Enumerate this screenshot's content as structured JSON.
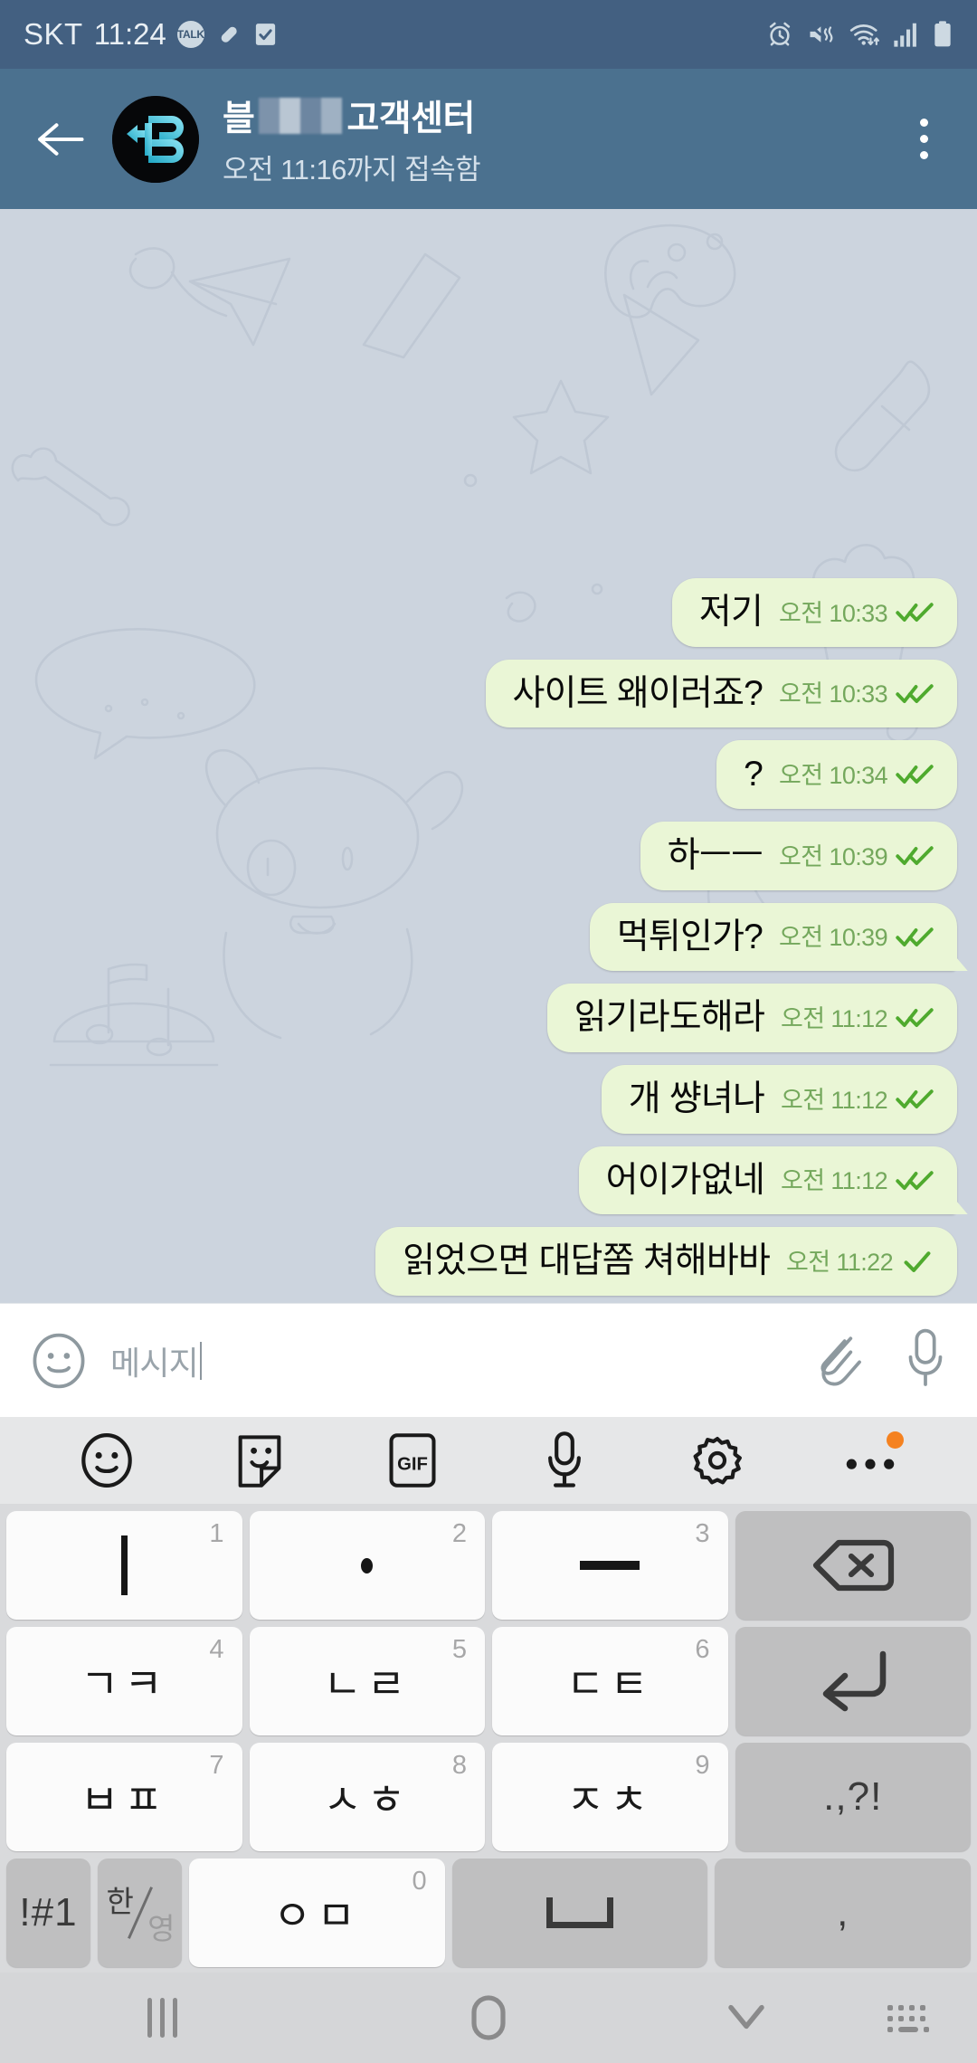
{
  "statusbar": {
    "carrier": "SKT",
    "time": "11:24",
    "talk_badge": "TALK",
    "icons_left": [
      "kakaotalk-icon",
      "pill-icon",
      "checkbox-icon"
    ],
    "icons_right": [
      "alarm-icon",
      "vibrate-mute-icon",
      "wifi-icon",
      "signal-icon",
      "battery-icon"
    ],
    "bg_color": "#436081"
  },
  "header": {
    "back_label": "뒤로",
    "title_prefix": "블",
    "title_suffix": "고객센터",
    "title_full": "블▯▯ 고객센터",
    "subtitle": "오전 11:16까지 접속함",
    "avatar_letter": "B",
    "menu_label": "더보기",
    "bg_color": "#4b718f"
  },
  "chat": {
    "bg_color": "#ccd4de",
    "bubble_color": "#eaf6d6",
    "time_color": "#74a85c",
    "messages": [
      {
        "text": "저기",
        "time": "오전 10:33",
        "ticks": "double",
        "tail": false
      },
      {
        "text": "사이트 왜이러죠?",
        "time": "오전 10:33",
        "ticks": "double",
        "tail": false
      },
      {
        "text": "?",
        "time": "오전 10:34",
        "ticks": "double",
        "tail": false
      },
      {
        "text": "하ㅡㅡ",
        "time": "오전 10:39",
        "ticks": "double",
        "tail": false
      },
      {
        "text": "먹튀인가?",
        "time": "오전 10:39",
        "ticks": "double",
        "tail": true
      },
      {
        "text": "읽기라도해라",
        "time": "오전 11:12",
        "ticks": "double",
        "tail": false
      },
      {
        "text": "개 썅녀나",
        "time": "오전 11:12",
        "ticks": "double",
        "tail": false
      },
      {
        "text": "어이가없네",
        "time": "오전 11:12",
        "ticks": "double",
        "tail": true
      },
      {
        "text": "읽었으면 대답쫌 쳐해바바",
        "time": "오전 11:22",
        "ticks": "single",
        "tail": false
      }
    ]
  },
  "inputbar": {
    "placeholder": "메시지",
    "value": "",
    "emoji_label": "이모티콘",
    "attach_label": "첨부",
    "mic_label": "음성 입력"
  },
  "keyboard": {
    "toolbar": [
      {
        "name": "emoji-icon",
        "label": "이모티콘",
        "badge": false
      },
      {
        "name": "sticker-icon",
        "label": "스티커",
        "badge": false
      },
      {
        "name": "gif-icon",
        "label": "GIF",
        "badge": false
      },
      {
        "name": "mic-icon",
        "label": "음성",
        "badge": false
      },
      {
        "name": "gear-icon",
        "label": "설정",
        "badge": false
      },
      {
        "name": "more-icon",
        "label": "더보기",
        "badge": true
      }
    ],
    "badge_color": "#f58220",
    "rows": [
      [
        {
          "main": "ㅣ",
          "num": "1",
          "type": "glyph-bar-v",
          "fn": false
        },
        {
          "main": "·",
          "num": "2",
          "type": "glyph-dot",
          "fn": false
        },
        {
          "main": "ㅡ",
          "num": "3",
          "type": "glyph-bar-h",
          "fn": false
        },
        {
          "main": "⌫",
          "num": "",
          "type": "backspace",
          "fn": true
        }
      ],
      [
        {
          "main": "ㄱㅋ",
          "num": "4",
          "type": "text",
          "fn": false
        },
        {
          "main": "ㄴㄹ",
          "num": "5",
          "type": "text",
          "fn": false
        },
        {
          "main": "ㄷㅌ",
          "num": "6",
          "type": "text",
          "fn": false
        },
        {
          "main": "↵",
          "num": "",
          "type": "enter",
          "fn": true
        }
      ],
      [
        {
          "main": "ㅂㅍ",
          "num": "7",
          "type": "text",
          "fn": false
        },
        {
          "main": "ㅅㅎ",
          "num": "8",
          "type": "text",
          "fn": false
        },
        {
          "main": "ㅈㅊ",
          "num": "9",
          "type": "text",
          "fn": false
        },
        {
          "main": ".,?!",
          "num": "",
          "type": "punct",
          "fn": true
        }
      ]
    ],
    "bottom_row": {
      "symbols": "!#1",
      "lang_ko": "한",
      "lang_en": "영",
      "zero_key": "ㅇㅁ",
      "zero_num": "0",
      "space": "스페이스",
      "comma": ","
    }
  },
  "navbar": {
    "recent_label": "최근 앱",
    "home_label": "홈",
    "hide_keyboard_label": "키보드 숨기기",
    "switch_keyboard_label": "키보드 전환"
  }
}
